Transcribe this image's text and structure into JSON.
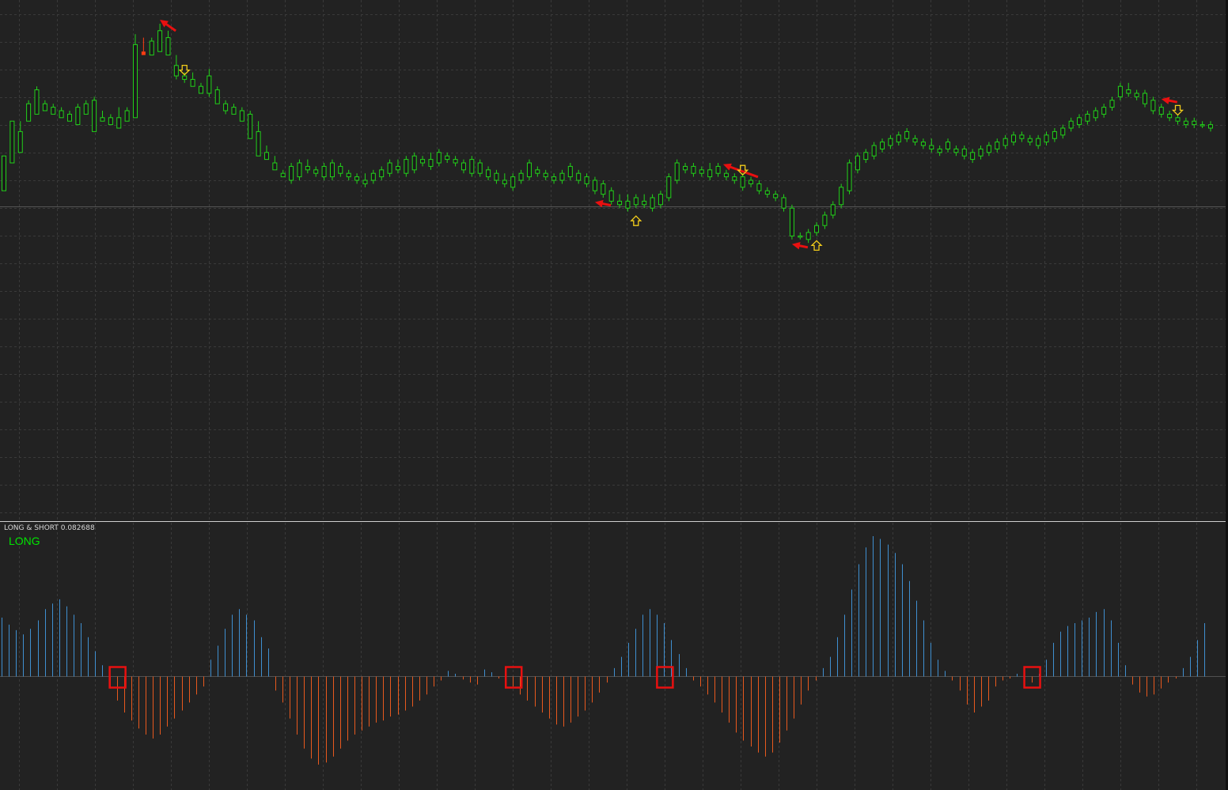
{
  "indicator": {
    "title": "LONG & SHORT 0.082688",
    "state": "LONG"
  },
  "colors": {
    "background": "#222222",
    "grid": "#3a3a3a",
    "bull": "#22d21a",
    "bear": "#ff3d12",
    "positive_hist": "#3f8fd0",
    "negative_hist": "#e8591e",
    "signal_arrow": "#e81010",
    "signal_box": "#e81010",
    "hint_arrow": "#f3cd1b"
  },
  "chart_data": [
    {
      "type": "candlestick",
      "name": "price",
      "ylim": [
        0,
        100
      ],
      "grid": true,
      "candles": [
        [
          52,
          52,
          62,
          62
        ],
        [
          60,
          60,
          72,
          72
        ],
        [
          63,
          63,
          69,
          72
        ],
        [
          72,
          72,
          77,
          78
        ],
        [
          74,
          74,
          81,
          82
        ],
        [
          75,
          75,
          77,
          78
        ],
        [
          74,
          74,
          76,
          77
        ],
        [
          73,
          73,
          75,
          76
        ],
        [
          72,
          72,
          74,
          75
        ],
        [
          71,
          71,
          76,
          77
        ],
        [
          74,
          74,
          77,
          78
        ],
        [
          69,
          69,
          78,
          79
        ],
        [
          72,
          72,
          73,
          75
        ],
        [
          71,
          71,
          73,
          74
        ],
        [
          70,
          70,
          73,
          76
        ],
        [
          72,
          72,
          75,
          76
        ],
        [
          73,
          73,
          94,
          97
        ],
        [
          92,
          92,
          91,
          96
        ],
        [
          91,
          91,
          95,
          96
        ],
        [
          92,
          92,
          98,
          100
        ],
        [
          91,
          91,
          96,
          98
        ],
        [
          85,
          84,
          88,
          91
        ],
        [
          84,
          83,
          85,
          86
        ],
        [
          82,
          82,
          84,
          86
        ],
        [
          80,
          80,
          82,
          83
        ],
        [
          80,
          79,
          85,
          87
        ],
        [
          77,
          77,
          81,
          82
        ],
        [
          75,
          74,
          77,
          78
        ],
        [
          74,
          74,
          76,
          77
        ],
        [
          72,
          72,
          75,
          76
        ],
        [
          67,
          67,
          74,
          75
        ],
        [
          62,
          62,
          69,
          72
        ],
        [
          61,
          61,
          63,
          65
        ],
        [
          58,
          58,
          60,
          62
        ],
        [
          56,
          56,
          57,
          58
        ],
        [
          55,
          54,
          59,
          60
        ],
        [
          56,
          55,
          60,
          61
        ],
        [
          58,
          57,
          59,
          61
        ],
        [
          57,
          56,
          58,
          59
        ],
        [
          56,
          55,
          59,
          60
        ],
        [
          56,
          55,
          60,
          61
        ],
        [
          57,
          56,
          59,
          60
        ],
        [
          56,
          55,
          57,
          58
        ],
        [
          55,
          54,
          56,
          57
        ],
        [
          54,
          53,
          55,
          57
        ],
        [
          55,
          54,
          57,
          58
        ],
        [
          56,
          55,
          58,
          59
        ],
        [
          57,
          56,
          60,
          61
        ],
        [
          58,
          57,
          59,
          61
        ],
        [
          57,
          56,
          61,
          62
        ],
        [
          58,
          57,
          62,
          63
        ],
        [
          60,
          59,
          61,
          62
        ],
        [
          59,
          58,
          61,
          63
        ],
        [
          60,
          59,
          63,
          64
        ],
        [
          61,
          60,
          62,
          63
        ],
        [
          60,
          59,
          61,
          62
        ],
        [
          58,
          57,
          60,
          61
        ],
        [
          57,
          56,
          61,
          62
        ],
        [
          57,
          56,
          60,
          61
        ],
        [
          56,
          55,
          58,
          59
        ],
        [
          55,
          54,
          57,
          58
        ],
        [
          54,
          53,
          55,
          57
        ],
        [
          53,
          52,
          56,
          57
        ],
        [
          55,
          54,
          57,
          58
        ],
        [
          56,
          55,
          60,
          61
        ],
        [
          57,
          56,
          58,
          59
        ],
        [
          56,
          55,
          57,
          58
        ],
        [
          55,
          54,
          56,
          57
        ],
        [
          55,
          54,
          57,
          58
        ],
        [
          56,
          55,
          59,
          60
        ],
        [
          55,
          54,
          57,
          58
        ],
        [
          54,
          53,
          56,
          57
        ],
        [
          52,
          51,
          55,
          56
        ],
        [
          51,
          50,
          54,
          55
        ],
        [
          49,
          48,
          52,
          53
        ],
        [
          48,
          47,
          49,
          51
        ],
        [
          47,
          46,
          49,
          51
        ],
        [
          48,
          47,
          50,
          51
        ],
        [
          48,
          47,
          49,
          51
        ],
        [
          47,
          46,
          50,
          51
        ],
        [
          48,
          47,
          51,
          52
        ],
        [
          50,
          49,
          56,
          57
        ],
        [
          55,
          54,
          60,
          61
        ],
        [
          58,
          57,
          59,
          60
        ],
        [
          57,
          56,
          59,
          60
        ],
        [
          57,
          56,
          58,
          59
        ],
        [
          56,
          55,
          58,
          60
        ],
        [
          57,
          56,
          59,
          60
        ],
        [
          56,
          55,
          57,
          58
        ],
        [
          55,
          54,
          56,
          57
        ],
        [
          53,
          52,
          56,
          57
        ],
        [
          54,
          53,
          55,
          56
        ],
        [
          52,
          51,
          54,
          55
        ],
        [
          51,
          50,
          52,
          53
        ],
        [
          50,
          49,
          51,
          52
        ],
        [
          47,
          46,
          50,
          51
        ],
        [
          39,
          38,
          47,
          48
        ],
        [
          39,
          38,
          39,
          40
        ],
        [
          38,
          37,
          40,
          41
        ],
        [
          40,
          39,
          42,
          43
        ],
        [
          42,
          41,
          45,
          46
        ],
        [
          45,
          44,
          48,
          49
        ],
        [
          48,
          47,
          53,
          54
        ],
        [
          52,
          51,
          60,
          61
        ],
        [
          58,
          57,
          62,
          63
        ],
        [
          61,
          60,
          63,
          64
        ],
        [
          62,
          61,
          65,
          66
        ],
        [
          64,
          63,
          66,
          67
        ],
        [
          65,
          64,
          67,
          68
        ],
        [
          66,
          65,
          68,
          69
        ],
        [
          67,
          66,
          69,
          70
        ],
        [
          66,
          65,
          67,
          68
        ],
        [
          65,
          64,
          66,
          67
        ],
        [
          64,
          63,
          65,
          67
        ],
        [
          63,
          62,
          64,
          65
        ],
        [
          64,
          63,
          66,
          67
        ],
        [
          63,
          62,
          64,
          65
        ],
        [
          62,
          61,
          64,
          65
        ],
        [
          61,
          60,
          63,
          64
        ],
        [
          62,
          61,
          64,
          65
        ],
        [
          63,
          62,
          65,
          66
        ],
        [
          64,
          63,
          66,
          67
        ],
        [
          65,
          64,
          67,
          68
        ],
        [
          66,
          65,
          68,
          69
        ],
        [
          67,
          66,
          68,
          69
        ],
        [
          66,
          65,
          67,
          68
        ],
        [
          65,
          64,
          67,
          68
        ],
        [
          66,
          65,
          68,
          69
        ],
        [
          67,
          66,
          69,
          70
        ],
        [
          68,
          67,
          70,
          71
        ],
        [
          70,
          69,
          72,
          73
        ],
        [
          71,
          70,
          73,
          74
        ],
        [
          72,
          71,
          74,
          75
        ],
        [
          73,
          72,
          75,
          76
        ],
        [
          74,
          73,
          76,
          77
        ],
        [
          76,
          75,
          78,
          79
        ],
        [
          79,
          78,
          82,
          83
        ],
        [
          80,
          79,
          81,
          83
        ],
        [
          79,
          78,
          80,
          81
        ],
        [
          77,
          76,
          80,
          81
        ],
        [
          75,
          74,
          78,
          79
        ],
        [
          74,
          73,
          76,
          77
        ],
        [
          73,
          72,
          74,
          75
        ],
        [
          72,
          71,
          73,
          74
        ],
        [
          71,
          70,
          72,
          73
        ],
        [
          71,
          70,
          72,
          73
        ],
        [
          71,
          70,
          71,
          72
        ],
        [
          70,
          69,
          71,
          72
        ]
      ]
    },
    {
      "type": "bar",
      "name": "long_short_histogram",
      "ylim": [
        -1,
        1
      ],
      "values": [
        0.42,
        0.37,
        0.33,
        0.3,
        0.34,
        0.4,
        0.48,
        0.52,
        0.55,
        0.5,
        0.44,
        0.38,
        0.28,
        0.18,
        0.08,
        -0.12,
        -0.24,
        -0.36,
        -0.44,
        -0.52,
        -0.58,
        -0.62,
        -0.58,
        -0.5,
        -0.42,
        -0.34,
        -0.26,
        -0.18,
        -0.1,
        0.12,
        0.22,
        0.34,
        0.44,
        0.48,
        0.44,
        0.4,
        0.28,
        0.2,
        -0.14,
        -0.26,
        -0.42,
        -0.58,
        -0.72,
        -0.82,
        -0.88,
        -0.86,
        -0.8,
        -0.72,
        -0.64,
        -0.58,
        -0.54,
        -0.5,
        -0.46,
        -0.44,
        -0.4,
        -0.38,
        -0.34,
        -0.3,
        -0.24,
        -0.18,
        -0.1,
        -0.04,
        0.04,
        0.02,
        -0.03,
        -0.06,
        -0.08,
        0.05,
        0.03,
        -0.02,
        -0.06,
        -0.1,
        -0.18,
        -0.24,
        -0.3,
        -0.36,
        -0.42,
        -0.48,
        -0.5,
        -0.46,
        -0.4,
        -0.34,
        -0.26,
        -0.16,
        -0.06,
        0.06,
        0.14,
        0.24,
        0.34,
        0.44,
        0.48,
        0.44,
        0.38,
        0.26,
        0.16,
        0.06,
        -0.04,
        -0.1,
        -0.18,
        -0.26,
        -0.36,
        -0.46,
        -0.56,
        -0.64,
        -0.7,
        -0.76,
        -0.8,
        -0.76,
        -0.66,
        -0.54,
        -0.42,
        -0.28,
        -0.14,
        -0.04,
        0.06,
        0.14,
        0.28,
        0.44,
        0.62,
        0.8,
        0.92,
        1.0,
        0.98,
        0.94,
        0.88,
        0.8,
        0.68,
        0.54,
        0.4,
        0.24,
        0.12,
        0.04,
        -0.04,
        -0.14,
        -0.28,
        -0.36,
        -0.3,
        -0.24,
        -0.1,
        -0.04,
        -0.02,
        0.02,
        -0.02,
        -0.06,
        0.02,
        0.12,
        0.24,
        0.32,
        0.36,
        0.38,
        0.4,
        0.42,
        0.46,
        0.48,
        0.4,
        0.24,
        0.08,
        -0.08,
        -0.16,
        -0.2,
        -0.18,
        -0.12,
        -0.06,
        -0.02,
        0.06,
        0.14,
        0.26,
        0.38
      ]
    }
  ],
  "signals": [
    {
      "candle": 19,
      "kind": "arrow",
      "dir": "down-left",
      "offset": -5
    },
    {
      "candle": 22,
      "kind": "hint",
      "dir": "down",
      "offset": -3
    },
    {
      "candle": 72,
      "kind": "arrow",
      "dir": "left",
      "offset": 10
    },
    {
      "candle": 77,
      "kind": "hint",
      "dir": "up",
      "offset": 10
    },
    {
      "candle": 88,
      "kind": "arrow",
      "dir": "left-up",
      "offset": -7
    },
    {
      "candle": 90,
      "kind": "hint",
      "dir": "down",
      "offset": -4
    },
    {
      "candle": 96,
      "kind": "arrow",
      "dir": "left",
      "offset": 6
    },
    {
      "candle": 99,
      "kind": "hint",
      "dir": "up",
      "offset": 6
    },
    {
      "candle": 141,
      "kind": "arrow",
      "dir": "left",
      "offset": -6
    },
    {
      "candle": 143,
      "kind": "hint",
      "dir": "down",
      "offset": -5
    }
  ],
  "hist_boxes": [
    16,
    71,
    92,
    143
  ]
}
